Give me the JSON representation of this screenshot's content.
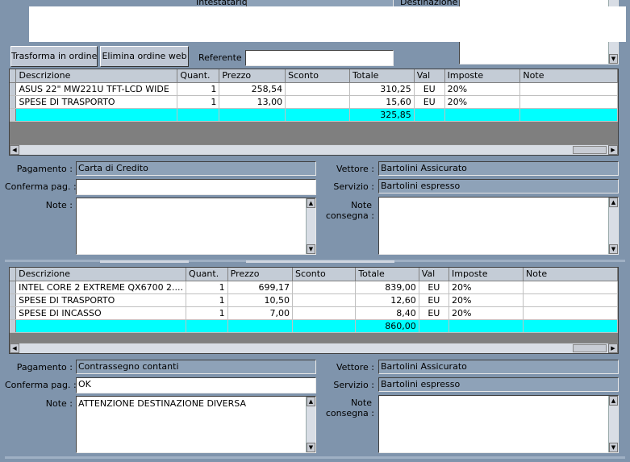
{
  "top": {
    "intestatario_label": "Intestatario :",
    "destinazione_label": "Destinazione :",
    "referente_label": "Referente :",
    "referente_value": "",
    "buttons": {
      "trasforma": "Trasforma in ordine",
      "elimina": "Elimina ordine web"
    }
  },
  "columns": [
    "Descrizione",
    "Quant.",
    "Prezzo",
    "Sconto",
    "Totale",
    "Val",
    "Imposte",
    "Note"
  ],
  "order1": {
    "rows": [
      {
        "descrizione": "ASUS 22\"  MW221U TFT-LCD WIDE",
        "quant": "1",
        "prezzo": "258,54",
        "sconto": "",
        "totale": "310,25",
        "val": "EU",
        "imposte": "20%",
        "note": ""
      },
      {
        "descrizione": "SPESE DI TRASPORTO",
        "quant": "1",
        "prezzo": "13,00",
        "sconto": "",
        "totale": "15,60",
        "val": "EU",
        "imposte": "20%",
        "note": ""
      }
    ],
    "total": "325,85",
    "pagamento_label": "Pagamento :",
    "pagamento": "Carta di Credito",
    "conferma_label": "Conferma pag. :",
    "conferma": "",
    "note_label": "Note :",
    "note": "",
    "vettore_label": "Vettore :",
    "vettore": "Bartolini Assicurato",
    "servizio_label": "Servizio :",
    "servizio": "Bartolini espresso",
    "note_consegna_label_1": "Note",
    "note_consegna_label_2": "consegna :",
    "note_consegna": ""
  },
  "order2": {
    "rows": [
      {
        "descrizione": "INTEL CORE 2 EXTREME QX6700 2....",
        "quant": "1",
        "prezzo": "699,17",
        "sconto": "",
        "totale": "839,00",
        "val": "EU",
        "imposte": "20%",
        "note": ""
      },
      {
        "descrizione": "SPESE DI TRASPORTO",
        "quant": "1",
        "prezzo": "10,50",
        "sconto": "",
        "totale": "12,60",
        "val": "EU",
        "imposte": "20%",
        "note": ""
      },
      {
        "descrizione": "SPESE DI INCASSO",
        "quant": "1",
        "prezzo": "7,00",
        "sconto": "",
        "totale": "8,40",
        "val": "EU",
        "imposte": "20%",
        "note": ""
      }
    ],
    "total": "860,00",
    "pagamento_label": "Pagamento :",
    "pagamento": "Contrassegno contanti",
    "conferma_label": "Conferma pag. :",
    "conferma": "OK",
    "note_label": "Note :",
    "note": "ATTENZIONE DESTINAZIONE DIVERSA",
    "vettore_label": "Vettore :",
    "vettore": "Bartolini Assicurato",
    "servizio_label": "Servizio :",
    "servizio": "Bartolini espresso",
    "note_consegna_label_1": "Note",
    "note_consegna_label_2": "consegna :",
    "note_consegna": ""
  },
  "icons": {
    "scroll_up": "triangle-up",
    "scroll_down": "triangle-down",
    "scroll_left": "triangle-left",
    "scroll_right": "triangle-right"
  },
  "colors": {
    "background": "#7f94ac",
    "total_row": "#00ffff",
    "grid_empty": "#7f7f7f"
  }
}
